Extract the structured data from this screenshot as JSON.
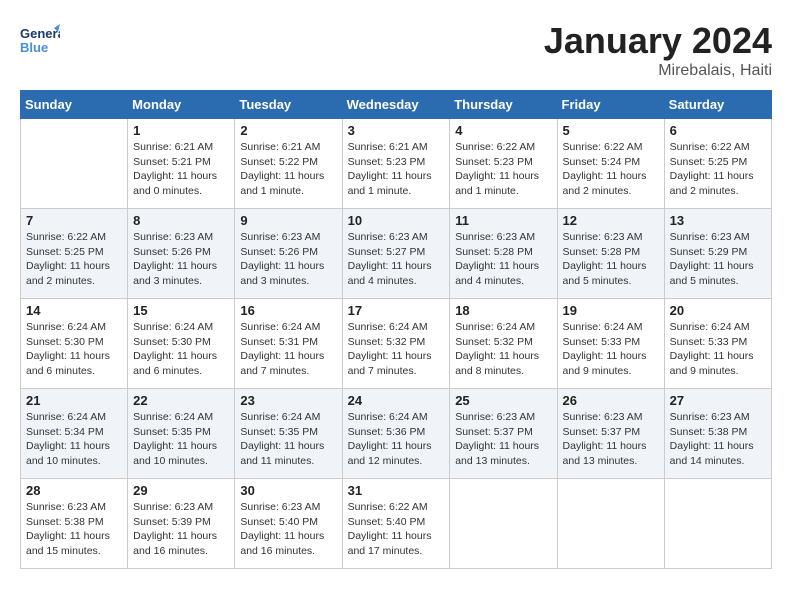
{
  "header": {
    "logo_general": "General",
    "logo_blue": "Blue",
    "month": "January 2024",
    "location": "Mirebalais, Haiti"
  },
  "days_of_week": [
    "Sunday",
    "Monday",
    "Tuesday",
    "Wednesday",
    "Thursday",
    "Friday",
    "Saturday"
  ],
  "weeks": [
    [
      {
        "day": "",
        "content": ""
      },
      {
        "day": "1",
        "content": "Sunrise: 6:21 AM\nSunset: 5:21 PM\nDaylight: 11 hours\nand 0 minutes."
      },
      {
        "day": "2",
        "content": "Sunrise: 6:21 AM\nSunset: 5:22 PM\nDaylight: 11 hours\nand 1 minute."
      },
      {
        "day": "3",
        "content": "Sunrise: 6:21 AM\nSunset: 5:23 PM\nDaylight: 11 hours\nand 1 minute."
      },
      {
        "day": "4",
        "content": "Sunrise: 6:22 AM\nSunset: 5:23 PM\nDaylight: 11 hours\nand 1 minute."
      },
      {
        "day": "5",
        "content": "Sunrise: 6:22 AM\nSunset: 5:24 PM\nDaylight: 11 hours\nand 2 minutes."
      },
      {
        "day": "6",
        "content": "Sunrise: 6:22 AM\nSunset: 5:25 PM\nDaylight: 11 hours\nand 2 minutes."
      }
    ],
    [
      {
        "day": "7",
        "content": "Sunrise: 6:22 AM\nSunset: 5:25 PM\nDaylight: 11 hours\nand 2 minutes."
      },
      {
        "day": "8",
        "content": "Sunrise: 6:23 AM\nSunset: 5:26 PM\nDaylight: 11 hours\nand 3 minutes."
      },
      {
        "day": "9",
        "content": "Sunrise: 6:23 AM\nSunset: 5:26 PM\nDaylight: 11 hours\nand 3 minutes."
      },
      {
        "day": "10",
        "content": "Sunrise: 6:23 AM\nSunset: 5:27 PM\nDaylight: 11 hours\nand 4 minutes."
      },
      {
        "day": "11",
        "content": "Sunrise: 6:23 AM\nSunset: 5:28 PM\nDaylight: 11 hours\nand 4 minutes."
      },
      {
        "day": "12",
        "content": "Sunrise: 6:23 AM\nSunset: 5:28 PM\nDaylight: 11 hours\nand 5 minutes."
      },
      {
        "day": "13",
        "content": "Sunrise: 6:23 AM\nSunset: 5:29 PM\nDaylight: 11 hours\nand 5 minutes."
      }
    ],
    [
      {
        "day": "14",
        "content": "Sunrise: 6:24 AM\nSunset: 5:30 PM\nDaylight: 11 hours\nand 6 minutes."
      },
      {
        "day": "15",
        "content": "Sunrise: 6:24 AM\nSunset: 5:30 PM\nDaylight: 11 hours\nand 6 minutes."
      },
      {
        "day": "16",
        "content": "Sunrise: 6:24 AM\nSunset: 5:31 PM\nDaylight: 11 hours\nand 7 minutes."
      },
      {
        "day": "17",
        "content": "Sunrise: 6:24 AM\nSunset: 5:32 PM\nDaylight: 11 hours\nand 7 minutes."
      },
      {
        "day": "18",
        "content": "Sunrise: 6:24 AM\nSunset: 5:32 PM\nDaylight: 11 hours\nand 8 minutes."
      },
      {
        "day": "19",
        "content": "Sunrise: 6:24 AM\nSunset: 5:33 PM\nDaylight: 11 hours\nand 9 minutes."
      },
      {
        "day": "20",
        "content": "Sunrise: 6:24 AM\nSunset: 5:33 PM\nDaylight: 11 hours\nand 9 minutes."
      }
    ],
    [
      {
        "day": "21",
        "content": "Sunrise: 6:24 AM\nSunset: 5:34 PM\nDaylight: 11 hours\nand 10 minutes."
      },
      {
        "day": "22",
        "content": "Sunrise: 6:24 AM\nSunset: 5:35 PM\nDaylight: 11 hours\nand 10 minutes."
      },
      {
        "day": "23",
        "content": "Sunrise: 6:24 AM\nSunset: 5:35 PM\nDaylight: 11 hours\nand 11 minutes."
      },
      {
        "day": "24",
        "content": "Sunrise: 6:24 AM\nSunset: 5:36 PM\nDaylight: 11 hours\nand 12 minutes."
      },
      {
        "day": "25",
        "content": "Sunrise: 6:23 AM\nSunset: 5:37 PM\nDaylight: 11 hours\nand 13 minutes."
      },
      {
        "day": "26",
        "content": "Sunrise: 6:23 AM\nSunset: 5:37 PM\nDaylight: 11 hours\nand 13 minutes."
      },
      {
        "day": "27",
        "content": "Sunrise: 6:23 AM\nSunset: 5:38 PM\nDaylight: 11 hours\nand 14 minutes."
      }
    ],
    [
      {
        "day": "28",
        "content": "Sunrise: 6:23 AM\nSunset: 5:38 PM\nDaylight: 11 hours\nand 15 minutes."
      },
      {
        "day": "29",
        "content": "Sunrise: 6:23 AM\nSunset: 5:39 PM\nDaylight: 11 hours\nand 16 minutes."
      },
      {
        "day": "30",
        "content": "Sunrise: 6:23 AM\nSunset: 5:40 PM\nDaylight: 11 hours\nand 16 minutes."
      },
      {
        "day": "31",
        "content": "Sunrise: 6:22 AM\nSunset: 5:40 PM\nDaylight: 11 hours\nand 17 minutes."
      },
      {
        "day": "",
        "content": ""
      },
      {
        "day": "",
        "content": ""
      },
      {
        "day": "",
        "content": ""
      }
    ]
  ]
}
